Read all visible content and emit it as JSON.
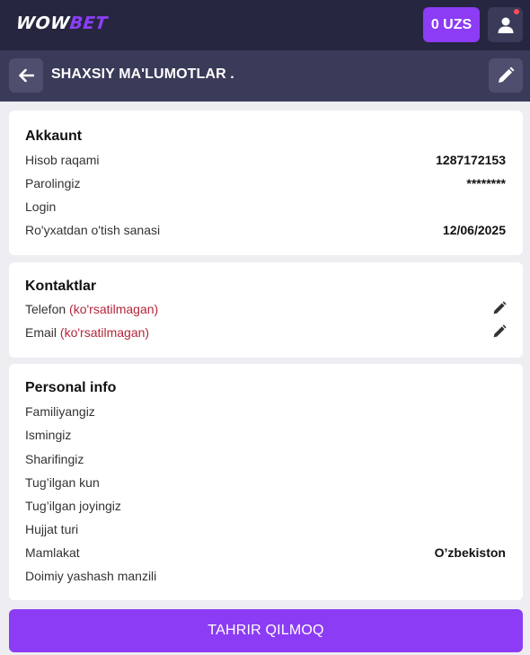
{
  "topbar": {
    "logo_part1": "WOW",
    "logo_part2": "BET",
    "balance": "0 UZS",
    "user_icon": "user-icon"
  },
  "header": {
    "title": "SHAXSIY MA'LUMOTLAR .",
    "back_icon": "arrow-left-icon",
    "edit_icon": "pencil-icon"
  },
  "account": {
    "title": "Akkaunt",
    "rows": [
      {
        "label": "Hisob raqami",
        "value": "1287172153"
      },
      {
        "label": "Parolingiz",
        "value": "********"
      },
      {
        "label": "Login",
        "value": ""
      },
      {
        "label": "Ro'yxatdan o'tish sanasi",
        "value": "12/06/2025"
      }
    ]
  },
  "contacts": {
    "title": "Kontaktlar",
    "rows": [
      {
        "label": "Telefon",
        "status": "(ko'rsatilmagan)"
      },
      {
        "label": "Email",
        "status": "(ko'rsatilmagan)"
      }
    ]
  },
  "personal": {
    "title": "Personal info",
    "rows": [
      {
        "label": "Familiyangiz",
        "value": ""
      },
      {
        "label": "Ismingiz",
        "value": ""
      },
      {
        "label": "Sharifingiz",
        "value": ""
      },
      {
        "label": "Tug’ilgan kun",
        "value": ""
      },
      {
        "label": "Tug’ilgan joyingiz",
        "value": ""
      },
      {
        "label": "Hujjat turi",
        "value": ""
      },
      {
        "label": "Mamlakat",
        "value": "O’zbekiston"
      },
      {
        "label": "Doimiy yashash manzili",
        "value": ""
      }
    ]
  },
  "footer": {
    "edit_button": "TAHRIR QILMOQ"
  },
  "colors": {
    "accent": "#8c3cf5",
    "topbar_bg": "#262641",
    "header_bg": "#3a3a59",
    "page_bg": "#eeeef2",
    "warning_text": "#b3263a"
  }
}
